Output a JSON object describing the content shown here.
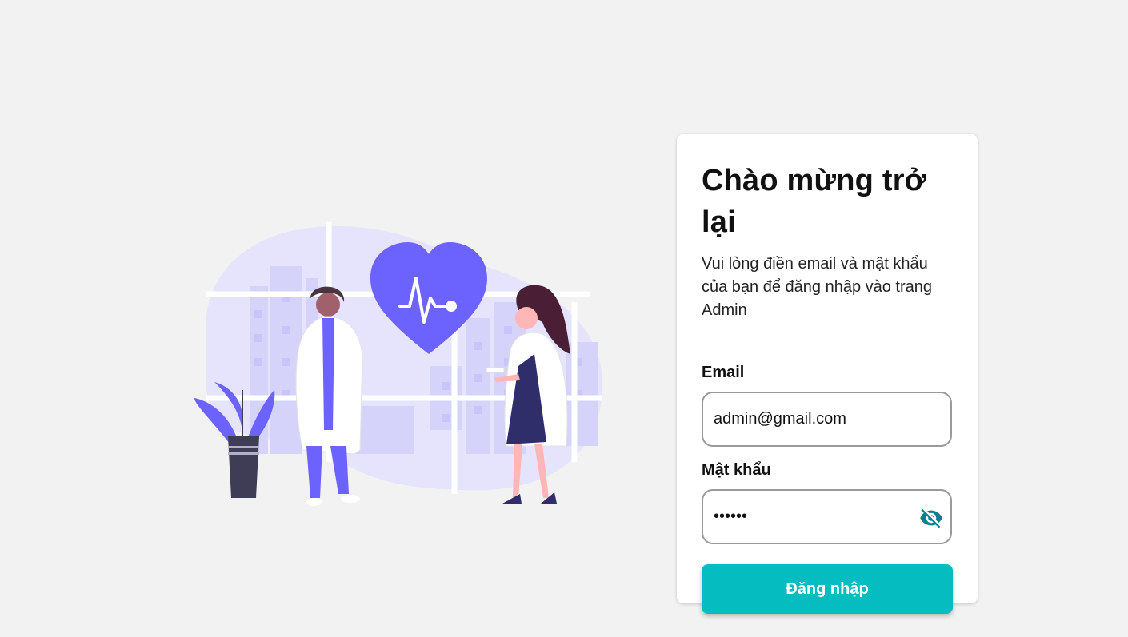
{
  "login": {
    "title": "Chào mừng trở lại",
    "subtitle": "Vui lòng điền email và mật khẩu của bạn để đăng nhập vào trang Admin",
    "email_label": "Email",
    "email_value": "admin@gmail.com",
    "password_label": "Mật khẩu",
    "password_value": "123456",
    "password_toggle_icon": "eye-off-icon",
    "submit_label": "Đăng nhập"
  },
  "colors": {
    "background": "#f2f2f2",
    "card": "#ffffff",
    "accent": "#05bcc0",
    "icon": "#00838f",
    "illustration_primary": "#6c63ff",
    "illustration_blob": "#e4e2fd"
  },
  "illustration": {
    "description_icon": "doctors-heart-illustration"
  }
}
